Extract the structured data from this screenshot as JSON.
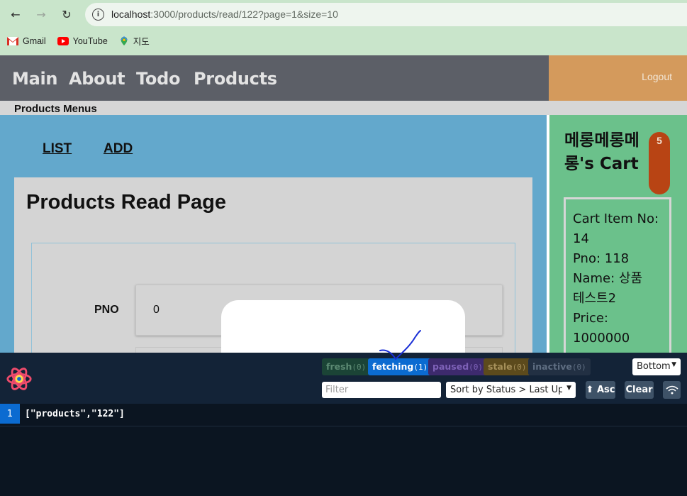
{
  "browser": {
    "back_icon": "←",
    "forward_icon": "→",
    "reload_icon": "↻",
    "url_host": "localhost",
    "url_rest": ":3000/products/read/122?page=1&size=10",
    "bookmarks": [
      {
        "label": "Gmail",
        "icon": "gmail-icon"
      },
      {
        "label": "YouTube",
        "icon": "youtube-icon"
      },
      {
        "label": "지도",
        "icon": "maps-icon"
      }
    ]
  },
  "nav": {
    "items": [
      "Main",
      "About",
      "Todo",
      "Products"
    ],
    "logout": "Logout"
  },
  "menus": {
    "title": "Products Menus"
  },
  "sub_links": {
    "list": "LIST",
    "add": "ADD"
  },
  "read": {
    "title": "Products Read Page",
    "pno_label": "PNO",
    "pno_value": "0"
  },
  "cart": {
    "title": "메롱메롱메롱's Cart",
    "badge": "5",
    "item_no_label": "Cart Item No:",
    "item_no_value": "14",
    "pno_text": "Pno: 118",
    "name_label": "Name: 상품",
    "name_value": "테스트2",
    "price_label": "Price:",
    "price_value": "1000000"
  },
  "devtools": {
    "status_pills": [
      {
        "label": "fresh",
        "count": "(0)"
      },
      {
        "label": "fetching",
        "count": "(1)"
      },
      {
        "label": "paused",
        "count": "(0)"
      },
      {
        "label": "stale",
        "count": "(0)"
      },
      {
        "label": "inactive",
        "count": "(0)"
      }
    ],
    "position_select": "Bottom",
    "filter_placeholder": "Filter",
    "sort_select": "Sort by Status > Last Updated",
    "asc_button": "⬆ Asc",
    "clear_button": "Clear",
    "query_rows": [
      {
        "count": "1",
        "key": "[\"products\",\"122\"]"
      }
    ]
  }
}
